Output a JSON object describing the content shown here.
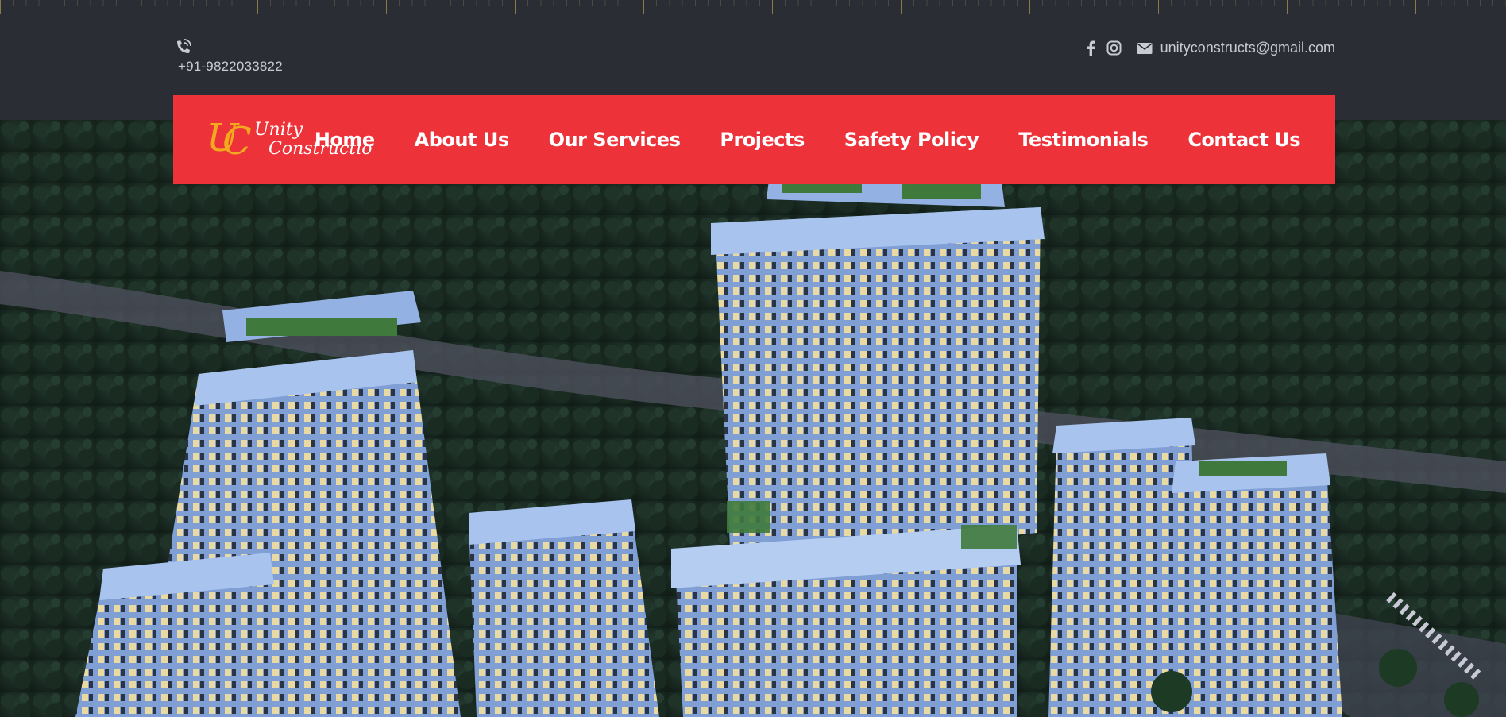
{
  "topbar": {
    "phone_icon": "phone-volume-icon",
    "phone_number": "+91-9822033822",
    "social": [
      {
        "name": "facebook-icon"
      },
      {
        "name": "instagram-icon"
      }
    ],
    "email_icon": "envelope-icon",
    "email": "unityconstructs@gmail.com"
  },
  "brand": {
    "monogram": "UC",
    "line1": "Unity",
    "line2": "Construction",
    "colors": {
      "monogram": "#f2a81f",
      "text": "#ffffff"
    }
  },
  "nav": {
    "items": [
      {
        "label": "Home"
      },
      {
        "label": "About Us"
      },
      {
        "label": "Our Services"
      },
      {
        "label": "Projects"
      },
      {
        "label": "Safety Policy"
      },
      {
        "label": "Testimonials"
      },
      {
        "label": "Contact Us"
      }
    ]
  },
  "colors": {
    "topbar_bg": "#2b2d35",
    "nav_bg": "#ed3239",
    "nav_text": "#ffffff",
    "topbar_text": "#c9cbd1"
  },
  "hero": {
    "image": "aerial-night-render-of-high-rise-towers-icon"
  }
}
